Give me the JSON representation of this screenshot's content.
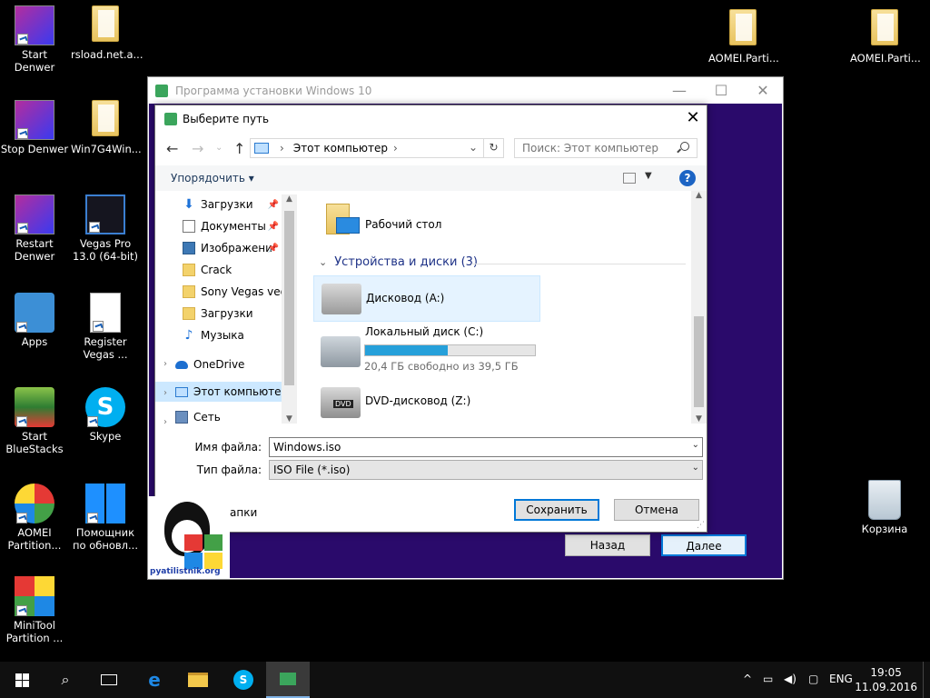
{
  "desktop": {
    "left_icons": [
      {
        "label": "Start Denwer"
      },
      {
        "label": "rsload.net.a..."
      },
      {
        "label": "Stop Denwer"
      },
      {
        "label": "Win7G4Win..."
      },
      {
        "label": "Restart Denwer"
      },
      {
        "label": "Vegas Pro 13.0 (64-bit)"
      },
      {
        "label": "Apps"
      },
      {
        "label": "Register Vegas ..."
      },
      {
        "label": "Start BlueStacks"
      },
      {
        "label": "Skype"
      },
      {
        "label": "AOMEI Partition..."
      },
      {
        "label": "Помощник по обновл..."
      },
      {
        "label": "MiniTool Partition ..."
      }
    ],
    "right_icons": [
      {
        "label": "AOMEI.Parti..."
      },
      {
        "label": "AOMEI.Parti..."
      }
    ],
    "recycle_bin": {
      "label": "Корзина"
    }
  },
  "setup_window": {
    "title": "Программа установки Windows 10",
    "back_label": "Назад",
    "next_label": "Далее"
  },
  "dialog": {
    "title": "Выберите путь",
    "address": {
      "location": "Этот компьютер"
    },
    "search": {
      "placeholder": "Поиск: Этот компьютер"
    },
    "toolbar": {
      "organize_label": "Упорядочить",
      "help_glyph": "?"
    },
    "nav": [
      {
        "label": "Загрузки",
        "icon": "download-icon",
        "pinned": true
      },
      {
        "label": "Документы",
        "icon": "document-icon",
        "pinned": true
      },
      {
        "label": "Изображени",
        "icon": "pictures-icon",
        "pinned": true
      },
      {
        "label": "Crack",
        "icon": "folder-icon",
        "pinned": false
      },
      {
        "label": "Sony Vegas vega",
        "icon": "folder-icon",
        "pinned": false
      },
      {
        "label": "Загрузки",
        "icon": "folder-icon",
        "pinned": false
      },
      {
        "label": "Музыка",
        "icon": "music-icon",
        "pinned": false
      },
      {
        "label": "OneDrive",
        "icon": "onedrive-icon",
        "pinned": false
      },
      {
        "label": "Этот компьютер",
        "icon": "this-pc-icon",
        "pinned": false,
        "selected": true
      },
      {
        "label": "Сеть",
        "icon": "network-icon",
        "pinned": false
      }
    ],
    "content": {
      "folders": [
        {
          "label": "Рабочий стол"
        }
      ],
      "group_title": "Устройства и диски (3)",
      "drives": [
        {
          "label": "Дисковод (A:)"
        },
        {
          "label": "Локальный диск (C:)",
          "free_text": "20,4 ГБ свободно из 39,5 ГБ",
          "used_fraction": 0.484
        },
        {
          "label": "DVD-дисковод (Z:)",
          "badge": "DVD"
        }
      ]
    },
    "filename": {
      "label": "Имя файла:",
      "value": "Windows.iso"
    },
    "filetype": {
      "label": "Тип файла:",
      "value": "ISO File (*.iso)"
    },
    "hide_folders_label": "апки",
    "save_label": "Сохранить",
    "cancel_label": "Отмена"
  },
  "watermark": {
    "text": "pyatilistnik.org"
  },
  "taskbar": {
    "language": "ENG",
    "time": "19:05",
    "date": "11.09.2016"
  },
  "colors": {
    "setup_background": "#2a0a6b",
    "selection": "#cce8ff",
    "progress": "#26a0da",
    "accent": "#0078d7"
  }
}
